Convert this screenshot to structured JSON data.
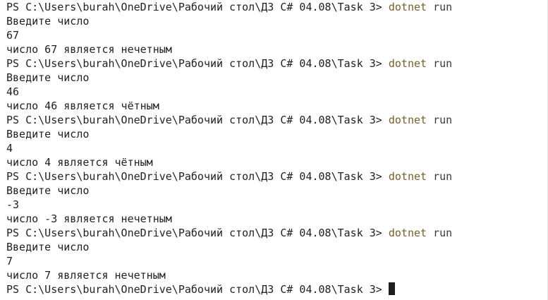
{
  "prompt": "PS C:\\Users\\burah\\OneDrive\\Рабочий стол\\ДЗ C# 04.08\\Task 3> ",
  "command": "dotnet",
  "command_arg": "run",
  "runs": [
    {
      "ask": "Введите число",
      "input": "67",
      "result": "число 67 является нечетным"
    },
    {
      "ask": "Введите число",
      "input": "46",
      "result": "число 46 является чётным"
    },
    {
      "ask": "Введите число",
      "input": "4",
      "result": "число 4 является чётным"
    },
    {
      "ask": "Введите число",
      "input": "-3",
      "result": "число -3 является нечетным"
    },
    {
      "ask": "Введите число",
      "input": "7",
      "result": "число 7 является нечетным"
    }
  ]
}
